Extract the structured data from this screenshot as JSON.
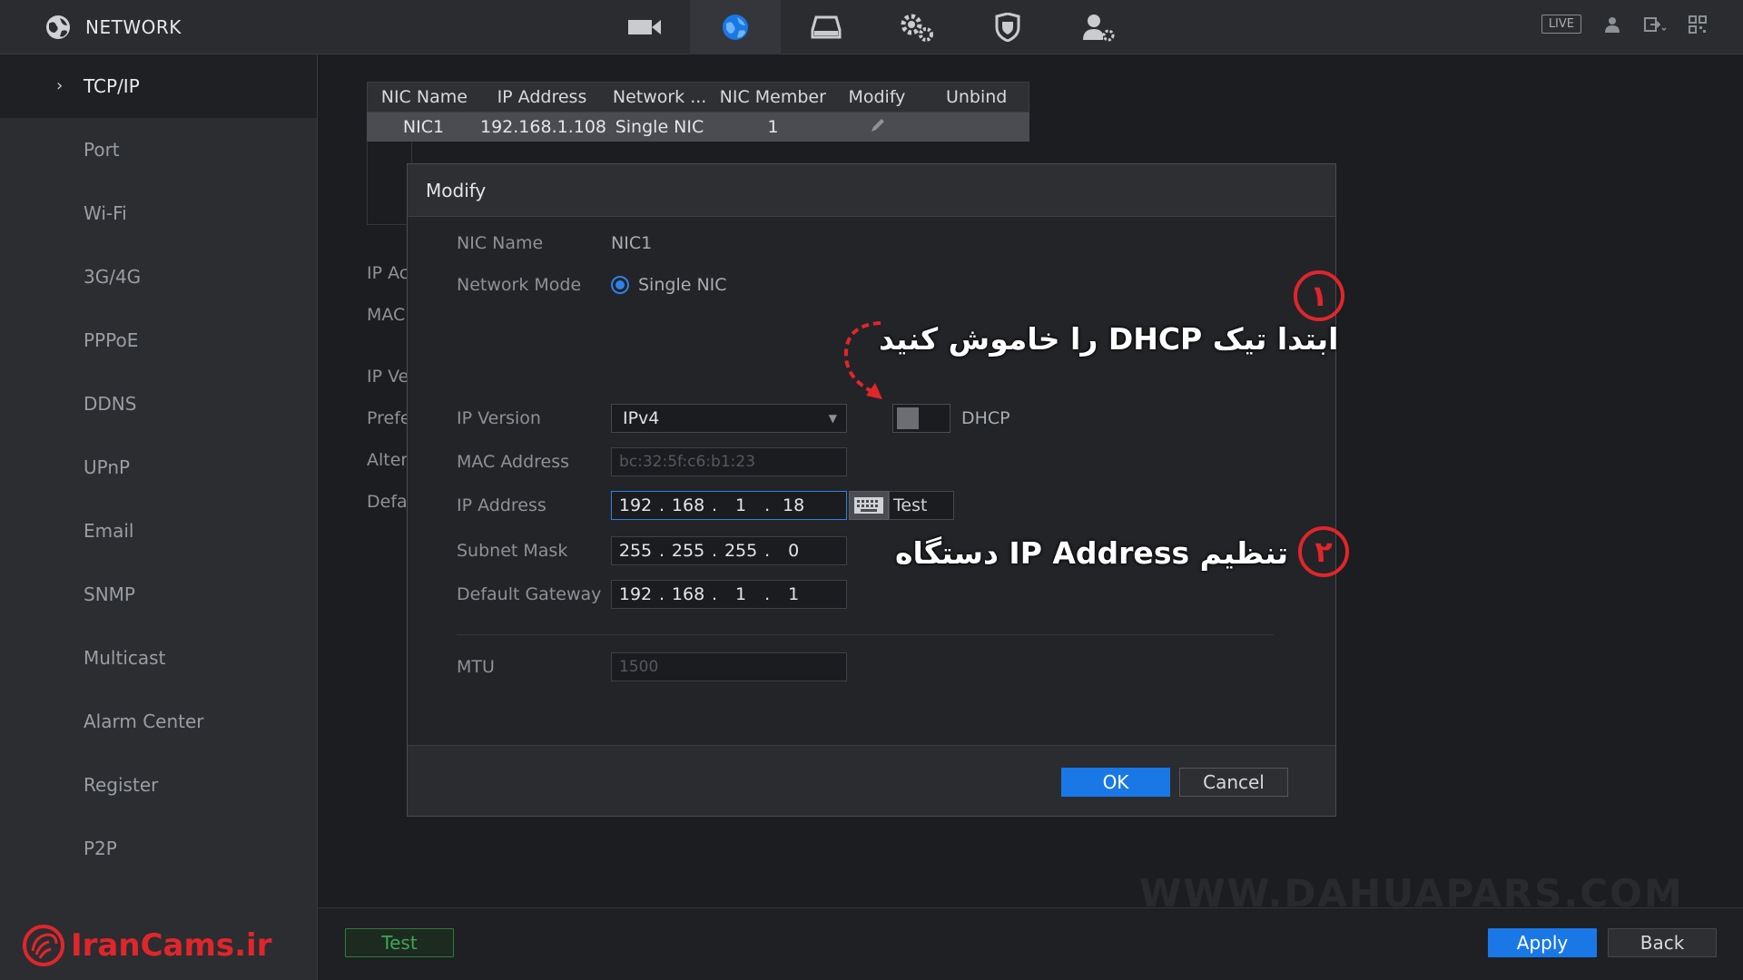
{
  "header": {
    "title": "NETWORK",
    "live_label": "LIVE",
    "nav": [
      "camera-icon",
      "network-icon",
      "storage-icon",
      "system-settings-icon",
      "security-icon",
      "account-icon"
    ]
  },
  "sidebar": {
    "items": [
      {
        "label": "TCP/IP"
      },
      {
        "label": "Port"
      },
      {
        "label": "Wi-Fi"
      },
      {
        "label": "3G/4G"
      },
      {
        "label": "PPPoE"
      },
      {
        "label": "DDNS"
      },
      {
        "label": "UPnP"
      },
      {
        "label": "Email"
      },
      {
        "label": "SNMP"
      },
      {
        "label": "Multicast"
      },
      {
        "label": "Alarm Center"
      },
      {
        "label": "Register"
      },
      {
        "label": "P2P"
      }
    ],
    "logo_text": "IranCams.ir"
  },
  "nic_table": {
    "headers": [
      "NIC Name",
      "IP Address",
      "Network ...",
      "NIC Member",
      "Modify",
      "Unbind"
    ],
    "row": {
      "name": "NIC1",
      "ip": "192.168.1.108",
      "network": "Single NIC",
      "member": "1"
    }
  },
  "background_labels": [
    "IP Ac",
    "MAC",
    "IP Ve",
    "Prefe",
    "Alter",
    "Defa"
  ],
  "modal": {
    "title": "Modify",
    "nic_name_label": "NIC Name",
    "nic_name_value": "NIC1",
    "network_mode_label": "Network Mode",
    "network_mode_value": "Single NIC",
    "ip_version_label": "IP Version",
    "ip_version_value": "IPv4",
    "dhcp_label": "DHCP",
    "mac_label": "MAC Address",
    "mac_value": "bc:32:5f:c6:b1:23",
    "ip_label": "IP Address",
    "ip_octets": [
      "192",
      "168",
      "1",
      "18"
    ],
    "test_label": "Test",
    "subnet_label": "Subnet Mask",
    "subnet_octets": [
      "255",
      "255",
      "255",
      "0"
    ],
    "gateway_label": "Default Gateway",
    "gateway_octets": [
      "192",
      "168",
      "1",
      "1"
    ],
    "mtu_label": "MTU",
    "mtu_value": "1500",
    "ok_label": "OK",
    "cancel_label": "Cancel"
  },
  "annotations": {
    "step1_text": "ابتدا تیک DHCP را خاموش کنید",
    "step1_num": "۱",
    "step2_text": "تنظیم IP Address دستگاه",
    "step2_num": "۲"
  },
  "footer": {
    "test_label": "Test",
    "apply_label": "Apply",
    "back_label": "Back"
  },
  "watermark": "WWW.DAHUAPARS.COM",
  "colors": {
    "accent": "#1a78e6",
    "annotation": "#e0262b",
    "test_green": "#3fa654"
  }
}
